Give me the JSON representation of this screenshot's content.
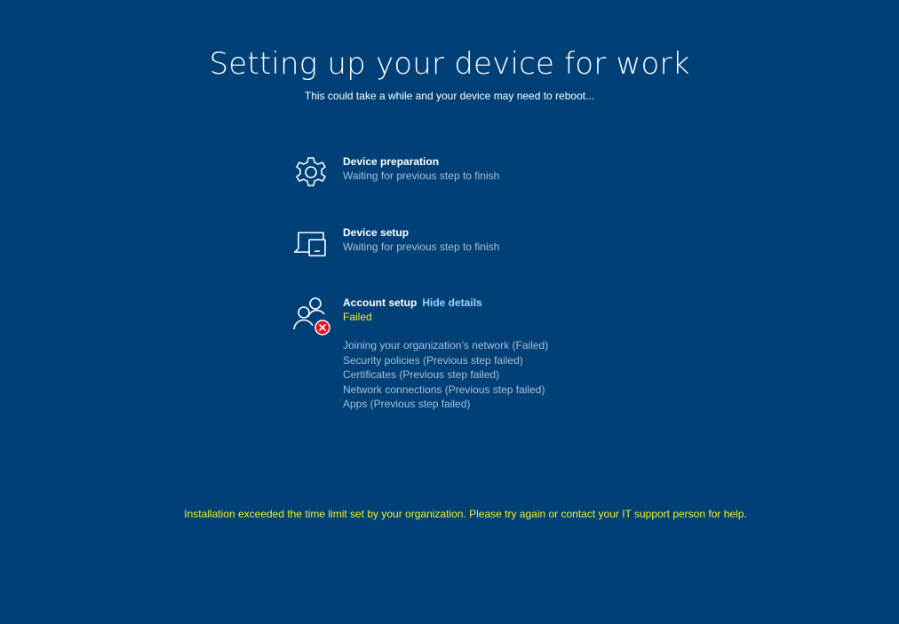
{
  "header": {
    "title": "Setting up your device for work",
    "subtitle": "This could take a while and your device may need to reboot..."
  },
  "steps": [
    {
      "title": "Device preparation",
      "status": "Waiting for previous step to finish",
      "icon": "gear-icon"
    },
    {
      "title": "Device setup",
      "status": "Waiting for previous step to finish",
      "icon": "device-icon"
    },
    {
      "title": "Account setup",
      "link": "Hide details",
      "status": "Failed",
      "icon": "account-error-icon",
      "details": [
        "Joining your organization’s network (Failed)",
        "Security policies (Previous step failed)",
        "Certificates (Previous step failed)",
        "Network connections (Previous step failed)",
        "Apps (Previous step failed)"
      ]
    }
  ],
  "footer": {
    "message": "Installation exceeded the time limit set by your organization. Please try again or contact your IT support person for help."
  },
  "colors": {
    "background": "#004077",
    "warning": "#f0f02a",
    "link": "#9fd0ff",
    "muted": "#a9bfd6",
    "error": "#e81123"
  }
}
